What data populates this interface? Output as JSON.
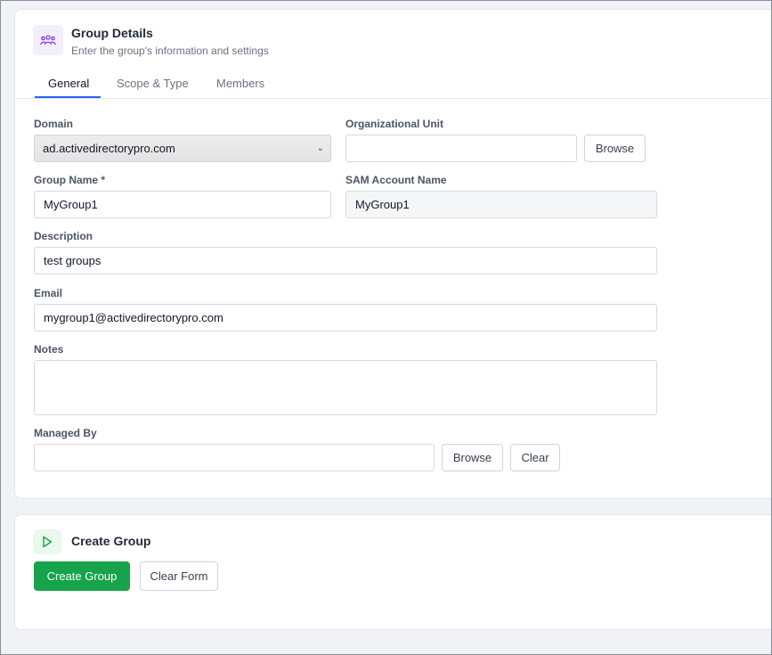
{
  "group_details": {
    "title": "Group Details",
    "subtitle": "Enter the group's information and settings",
    "icon": "users-group-icon"
  },
  "tabs": [
    {
      "label": "General",
      "active": true
    },
    {
      "label": "Scope & Type",
      "active": false
    },
    {
      "label": "Members",
      "active": false
    }
  ],
  "form": {
    "domain": {
      "label": "Domain",
      "value": "ad.activedirectorypro.com"
    },
    "ou": {
      "label": "Organizational Unit",
      "value": "",
      "browse_label": "Browse"
    },
    "group_name": {
      "label": "Group Name *",
      "value": "MyGroup1"
    },
    "sam_account": {
      "label": "SAM Account Name",
      "value": "MyGroup1"
    },
    "description": {
      "label": "Description",
      "value": "test groups"
    },
    "email": {
      "label": "Email",
      "value": "mygroup1@activedirectorypro.com"
    },
    "notes": {
      "label": "Notes",
      "value": ""
    },
    "managed_by": {
      "label": "Managed By",
      "value": "",
      "browse_label": "Browse",
      "clear_label": "Clear"
    }
  },
  "create_group": {
    "title": "Create Group",
    "icon": "play-icon",
    "create_label": "Create Group",
    "clear_label": "Clear Form"
  },
  "colors": {
    "accent": "#2563eb",
    "primary_button": "#16a34a",
    "icon_purple": "#7c3aed",
    "icon_green": "#16a34a"
  }
}
